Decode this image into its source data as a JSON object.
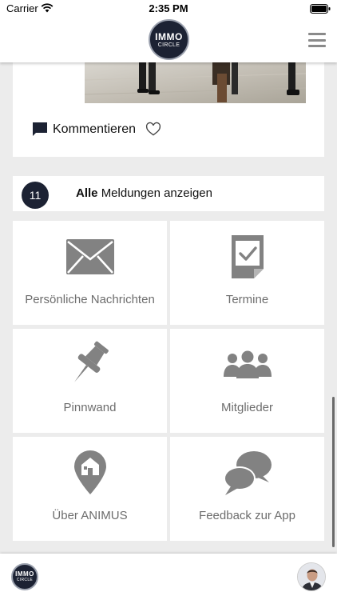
{
  "status_bar": {
    "carrier": "Carrier",
    "time": "2:35 PM"
  },
  "header": {
    "logo_line1": "IMMO",
    "logo_line2": "CIRCLE",
    "menu_icon": "hamburger-menu-icon"
  },
  "post": {
    "comment_label": "Kommentieren",
    "comment_icon": "comment-icon",
    "like_icon": "heart-outline-icon"
  },
  "notifications": {
    "count": "11",
    "label_bold": "Alle",
    "label_rest": "Meldungen anzeigen"
  },
  "tiles": [
    {
      "label": "Persönliche Nachrichten",
      "icon": "envelope-icon"
    },
    {
      "label": "Termine",
      "icon": "calendar-check-icon"
    },
    {
      "label": "Pinnwand",
      "icon": "pushpin-icon"
    },
    {
      "label": "Mitglieder",
      "icon": "group-icon"
    },
    {
      "label": "Über ANIMUS",
      "icon": "home-location-pin-icon"
    },
    {
      "label": "Feedback zur App",
      "icon": "chat-bubbles-icon"
    }
  ],
  "footer": {
    "logo_line1": "IMMO",
    "logo_line2": "CIRCLE",
    "avatar_icon": "user-avatar"
  },
  "colors": {
    "dark_navy": "#1c2233",
    "icon_grey": "#828282",
    "label_grey": "#6d6d6d",
    "background": "#ececec"
  }
}
